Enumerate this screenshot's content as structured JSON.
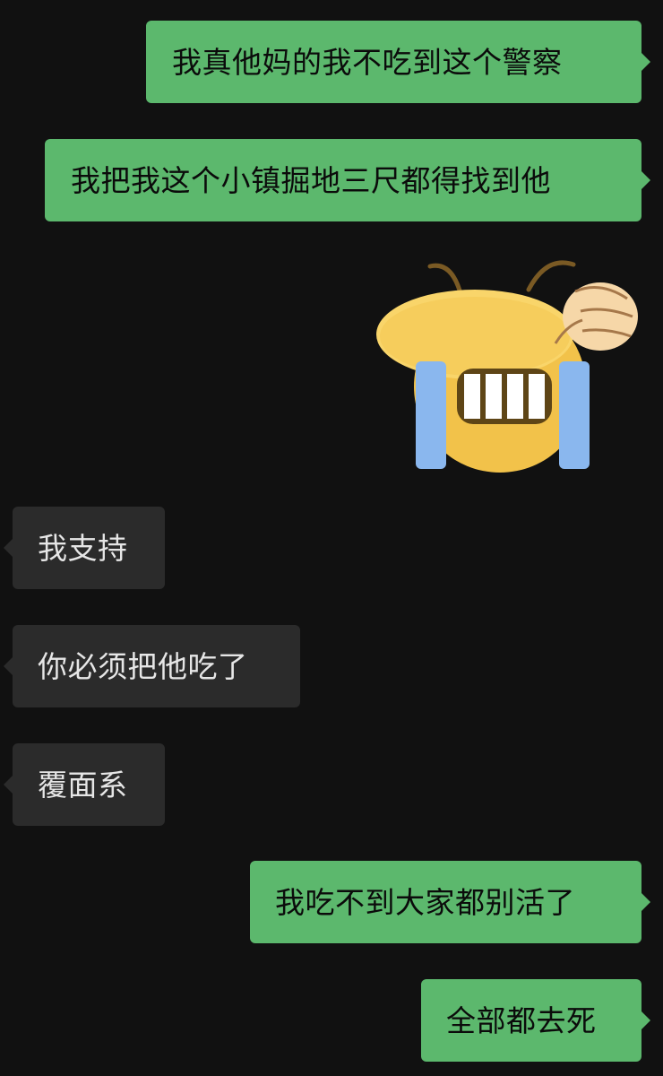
{
  "messages": [
    {
      "side": "out",
      "text": "我真他妈的我不吃到这个警察"
    },
    {
      "side": "out",
      "text": "我把我这个小镇掘地三尺都得找到他"
    },
    {
      "side": "out",
      "sticker": "crying-laughing-salute-emoji"
    },
    {
      "side": "in",
      "text": "我支持"
    },
    {
      "side": "in",
      "text": "你必须把他吃了"
    },
    {
      "side": "in",
      "text": "覆面系"
    },
    {
      "side": "out",
      "text": "我吃不到大家都别活了"
    },
    {
      "side": "out",
      "text": "全部都去死"
    }
  ],
  "colors": {
    "background": "#111111",
    "outgoing_bubble": "#5cb86d",
    "incoming_bubble": "#2b2b2b",
    "outgoing_text": "#0b0b0b",
    "incoming_text": "#e6e6e6"
  }
}
